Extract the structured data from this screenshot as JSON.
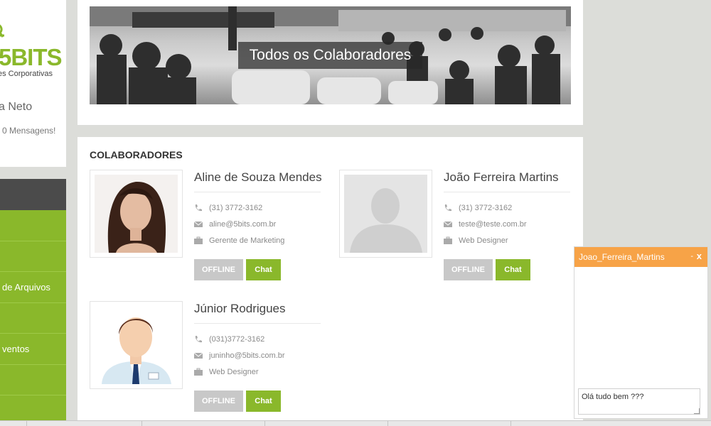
{
  "sidebar": {
    "logo_text": "5BITS",
    "logo_subtitle": "es Corporativas",
    "user_name": "a Neto",
    "messages": "0 Mensagens!",
    "nav_items": [
      "",
      "",
      "de Arquivos",
      "",
      "ventos",
      "",
      ""
    ]
  },
  "banner": {
    "title": "Todos os Colaboradores"
  },
  "collaborators": {
    "heading": "COLABORADORES",
    "offline_label": "OFFLINE",
    "chat_label": "Chat",
    "people": [
      {
        "name": "Aline de Souza Mendes",
        "phone": "(31) 3772-3162",
        "email": "aline@5bits.com.br",
        "role": "Gerente de Marketing"
      },
      {
        "name": "João Ferreira Martins",
        "phone": "(31) 3772-3162",
        "email": "teste@teste.com.br",
        "role": "Web Designer"
      },
      {
        "name": "Júnior Rodrigues",
        "phone": "(031)3772-3162",
        "email": "juninho@5bits.com.br",
        "role": "Web Designer"
      }
    ]
  },
  "chat": {
    "title": "Joao_Ferreira_Martins",
    "minimize": "-",
    "close": "x",
    "input_value": "Olá tudo bem ???"
  },
  "colors": {
    "brand_green": "#8ab82b",
    "chat_orange": "#f7a347",
    "dark_nav": "#4b4b4b"
  }
}
